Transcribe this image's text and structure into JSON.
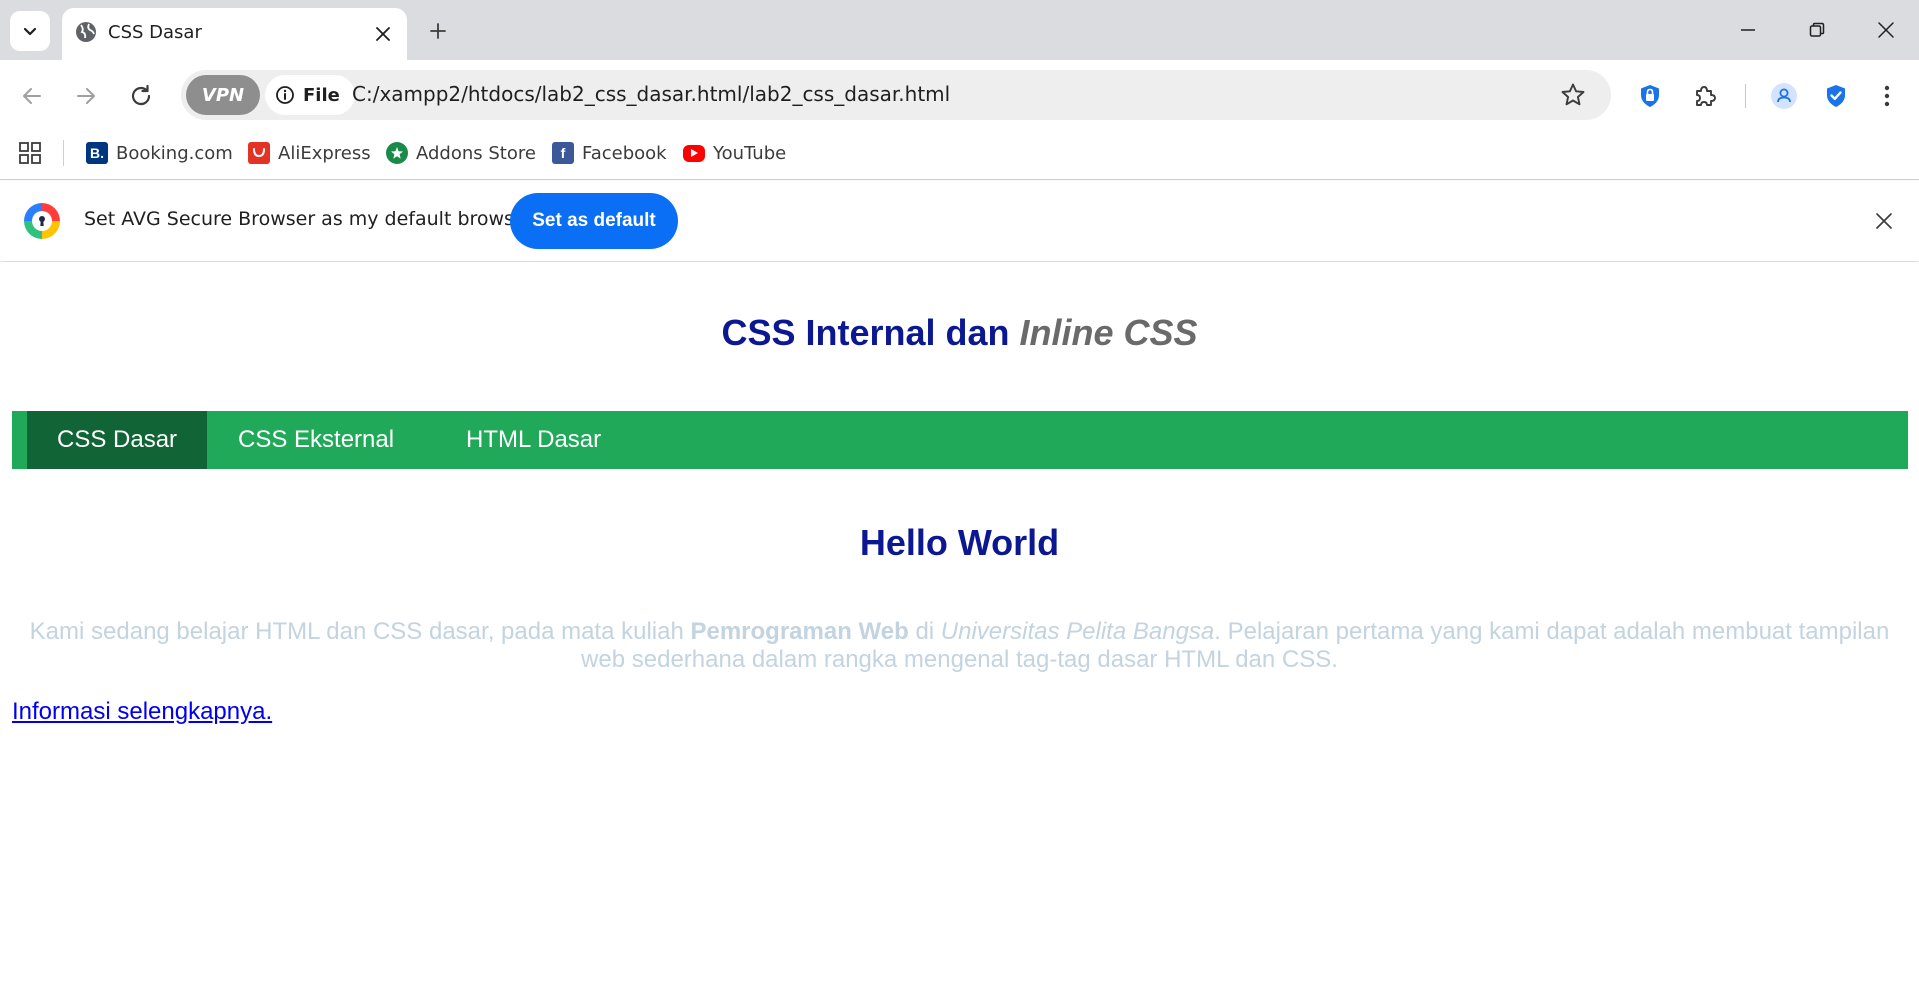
{
  "browser": {
    "tab": {
      "title": "CSS Dasar"
    },
    "vpn_label": "VPN",
    "chip_label": "File",
    "url": "C:/xampp2/htdocs/lab2_css_dasar.html/lab2_css_dasar.html"
  },
  "bookmarks": [
    {
      "label": "Booking.com",
      "icon": "booking-icon",
      "color": "#003580"
    },
    {
      "label": "AliExpress",
      "icon": "aliexpress-icon",
      "color": "#e43225"
    },
    {
      "label": "Addons Store",
      "icon": "addons-store-icon",
      "color": "#1a8a4a"
    },
    {
      "label": "Facebook",
      "icon": "facebook-icon",
      "color": "#1877f2"
    },
    {
      "label": "YouTube",
      "icon": "youtube-icon",
      "color": "#ff0000"
    }
  ],
  "infobar": {
    "message": "Set AVG Secure Browser as my default browser",
    "button_label": "Set as default"
  },
  "page": {
    "heading_part1": "CSS Internal dan ",
    "heading_part2": "Inline CSS",
    "nav": [
      "CSS Dasar",
      "CSS Eksternal",
      "HTML Dasar"
    ],
    "hello": "Hello World",
    "para_1": "Kami sedang belajar HTML dan CSS dasar, pada mata kuliah ",
    "para_bold": "Pemrograman Web",
    "para_2": " di ",
    "para_italic": "Universitas Pelita Bangsa",
    "para_3": ". Pelajaran pertama yang kami dapat adalah membuat tampilan web sederhana dalam rangka mengenal tag-tag dasar HTML dan CSS.",
    "link": "Informasi selengkapnya."
  },
  "colors": {
    "heading": "#0b1891",
    "nav_bg": "#21a95a",
    "nav_active": "#106436",
    "paragraph": "#c3d3e0",
    "button": "#0a6ff5"
  }
}
